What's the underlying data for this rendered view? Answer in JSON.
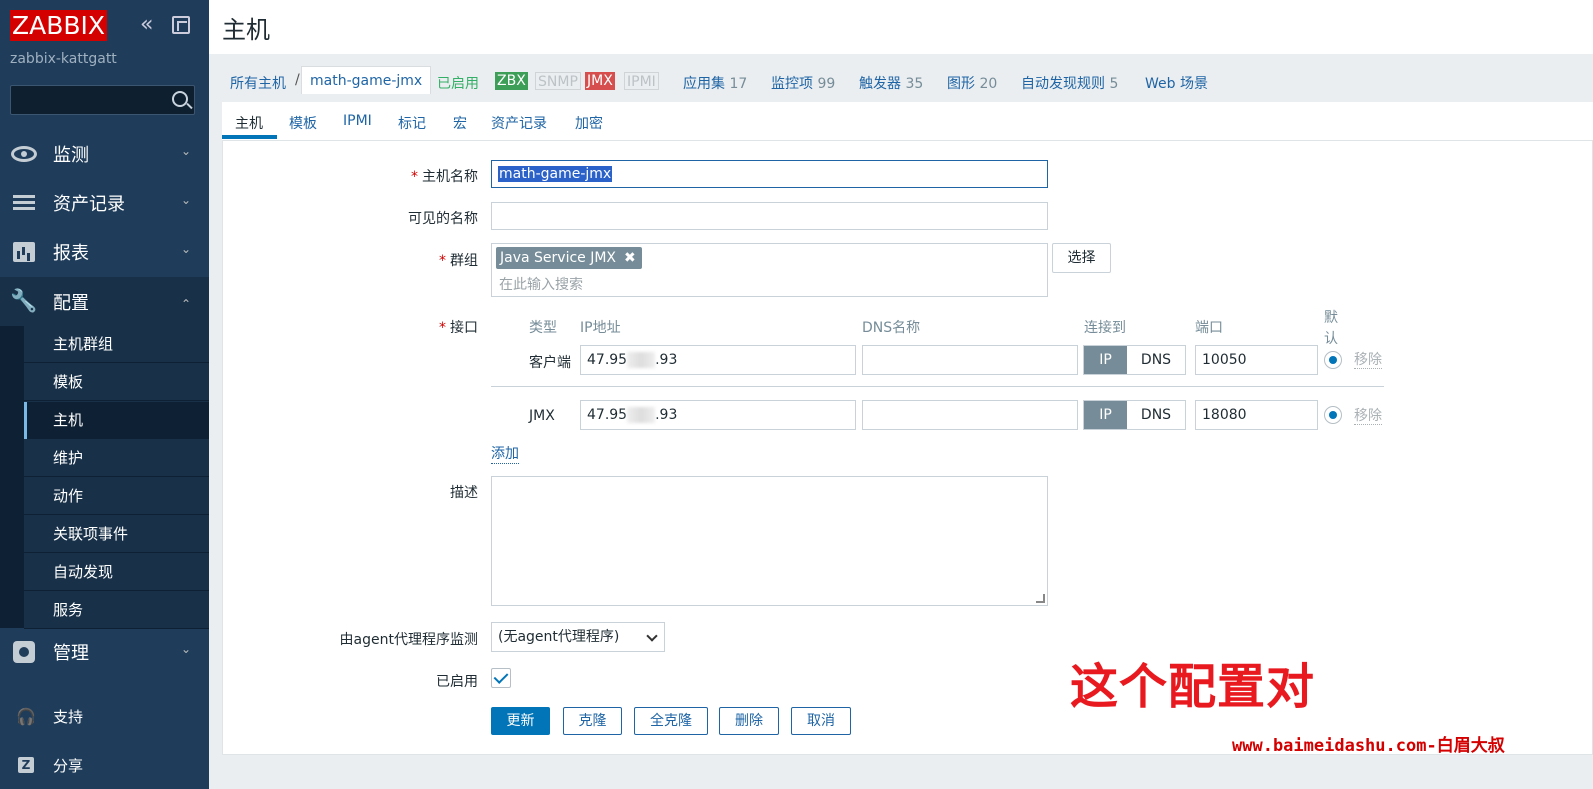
{
  "sidebar": {
    "logo": "ZABBIX",
    "server_name": "zabbix-kattgatt",
    "search_placeholder": "",
    "menu": [
      {
        "label": "监测"
      },
      {
        "label": "资产记录"
      },
      {
        "label": "报表"
      },
      {
        "label": "配置"
      },
      {
        "label": "管理"
      }
    ],
    "submenu": [
      {
        "label": "主机群组"
      },
      {
        "label": "模板"
      },
      {
        "label": "主机"
      },
      {
        "label": "维护"
      },
      {
        "label": "动作"
      },
      {
        "label": "关联项事件"
      },
      {
        "label": "自动发现"
      },
      {
        "label": "服务"
      }
    ],
    "utility": [
      {
        "label": "支持"
      },
      {
        "label": "分享"
      }
    ]
  },
  "page": {
    "title": "主机"
  },
  "host_nav": {
    "all_hosts": "所有主机",
    "separator": "/",
    "current_host": "math-game-jmx",
    "status": "已启用",
    "ifaces": {
      "zbx": "ZBX",
      "snmp": "SNMP",
      "jmx": "JMX",
      "ipmi": "IPMI"
    },
    "links": [
      {
        "label": "应用集",
        "count": "17"
      },
      {
        "label": "监控项",
        "count": "99"
      },
      {
        "label": "触发器",
        "count": "35"
      },
      {
        "label": "图形",
        "count": "20"
      },
      {
        "label": "自动发现规则",
        "count": "5"
      },
      {
        "label": "Web 场景",
        "count": ""
      }
    ]
  },
  "tabs": [
    {
      "label": "主机"
    },
    {
      "label": "模板"
    },
    {
      "label": "IPMI"
    },
    {
      "label": "标记"
    },
    {
      "label": "宏"
    },
    {
      "label": "资产记录"
    },
    {
      "label": "加密"
    }
  ],
  "form": {
    "host_name_label": "主机名称",
    "host_name_value": "math-game-jmx",
    "visible_name_label": "可见的名称",
    "visible_name_value": "",
    "groups_label": "群组",
    "group_chip": "Java Service JMX",
    "group_placeholder": "在此输入搜索",
    "select_button": "选择",
    "interfaces_label": "接口",
    "if_headers": {
      "type": "类型",
      "ip": "IP地址",
      "dns": "DNS名称",
      "connect": "连接到",
      "port": "端口",
      "default_1": "默",
      "default_2": "认"
    },
    "interfaces": [
      {
        "type": "客户端",
        "ip_prefix": "47.95",
        "ip_suffix": ".93",
        "dns": "",
        "on": "IP",
        "off": "DNS",
        "port": "10050",
        "remove": "移除"
      },
      {
        "type": "JMX",
        "ip_prefix": "47.95",
        "ip_suffix": ".93",
        "dns": "",
        "on": "IP",
        "off": "DNS",
        "port": "18080",
        "remove": "移除"
      }
    ],
    "add_link": "添加",
    "description_label": "描述",
    "description_value": "",
    "proxy_label": "由agent代理程序监测",
    "proxy_value": "(无agent代理程序)",
    "enabled_label": "已启用",
    "buttons": {
      "update": "更新",
      "clone": "克隆",
      "full_clone": "全克隆",
      "delete": "删除",
      "cancel": "取消"
    }
  },
  "overlay": {
    "annotation": "这个配置对",
    "watermark": "www.baimeidashu.com-白眉大叔"
  },
  "colors": {
    "sidebar_bg": "#1f3d5a",
    "accent": "#0275b8",
    "link": "#1f65a6",
    "annotation_red": "#e8191f",
    "logo_red": "#d40000"
  }
}
